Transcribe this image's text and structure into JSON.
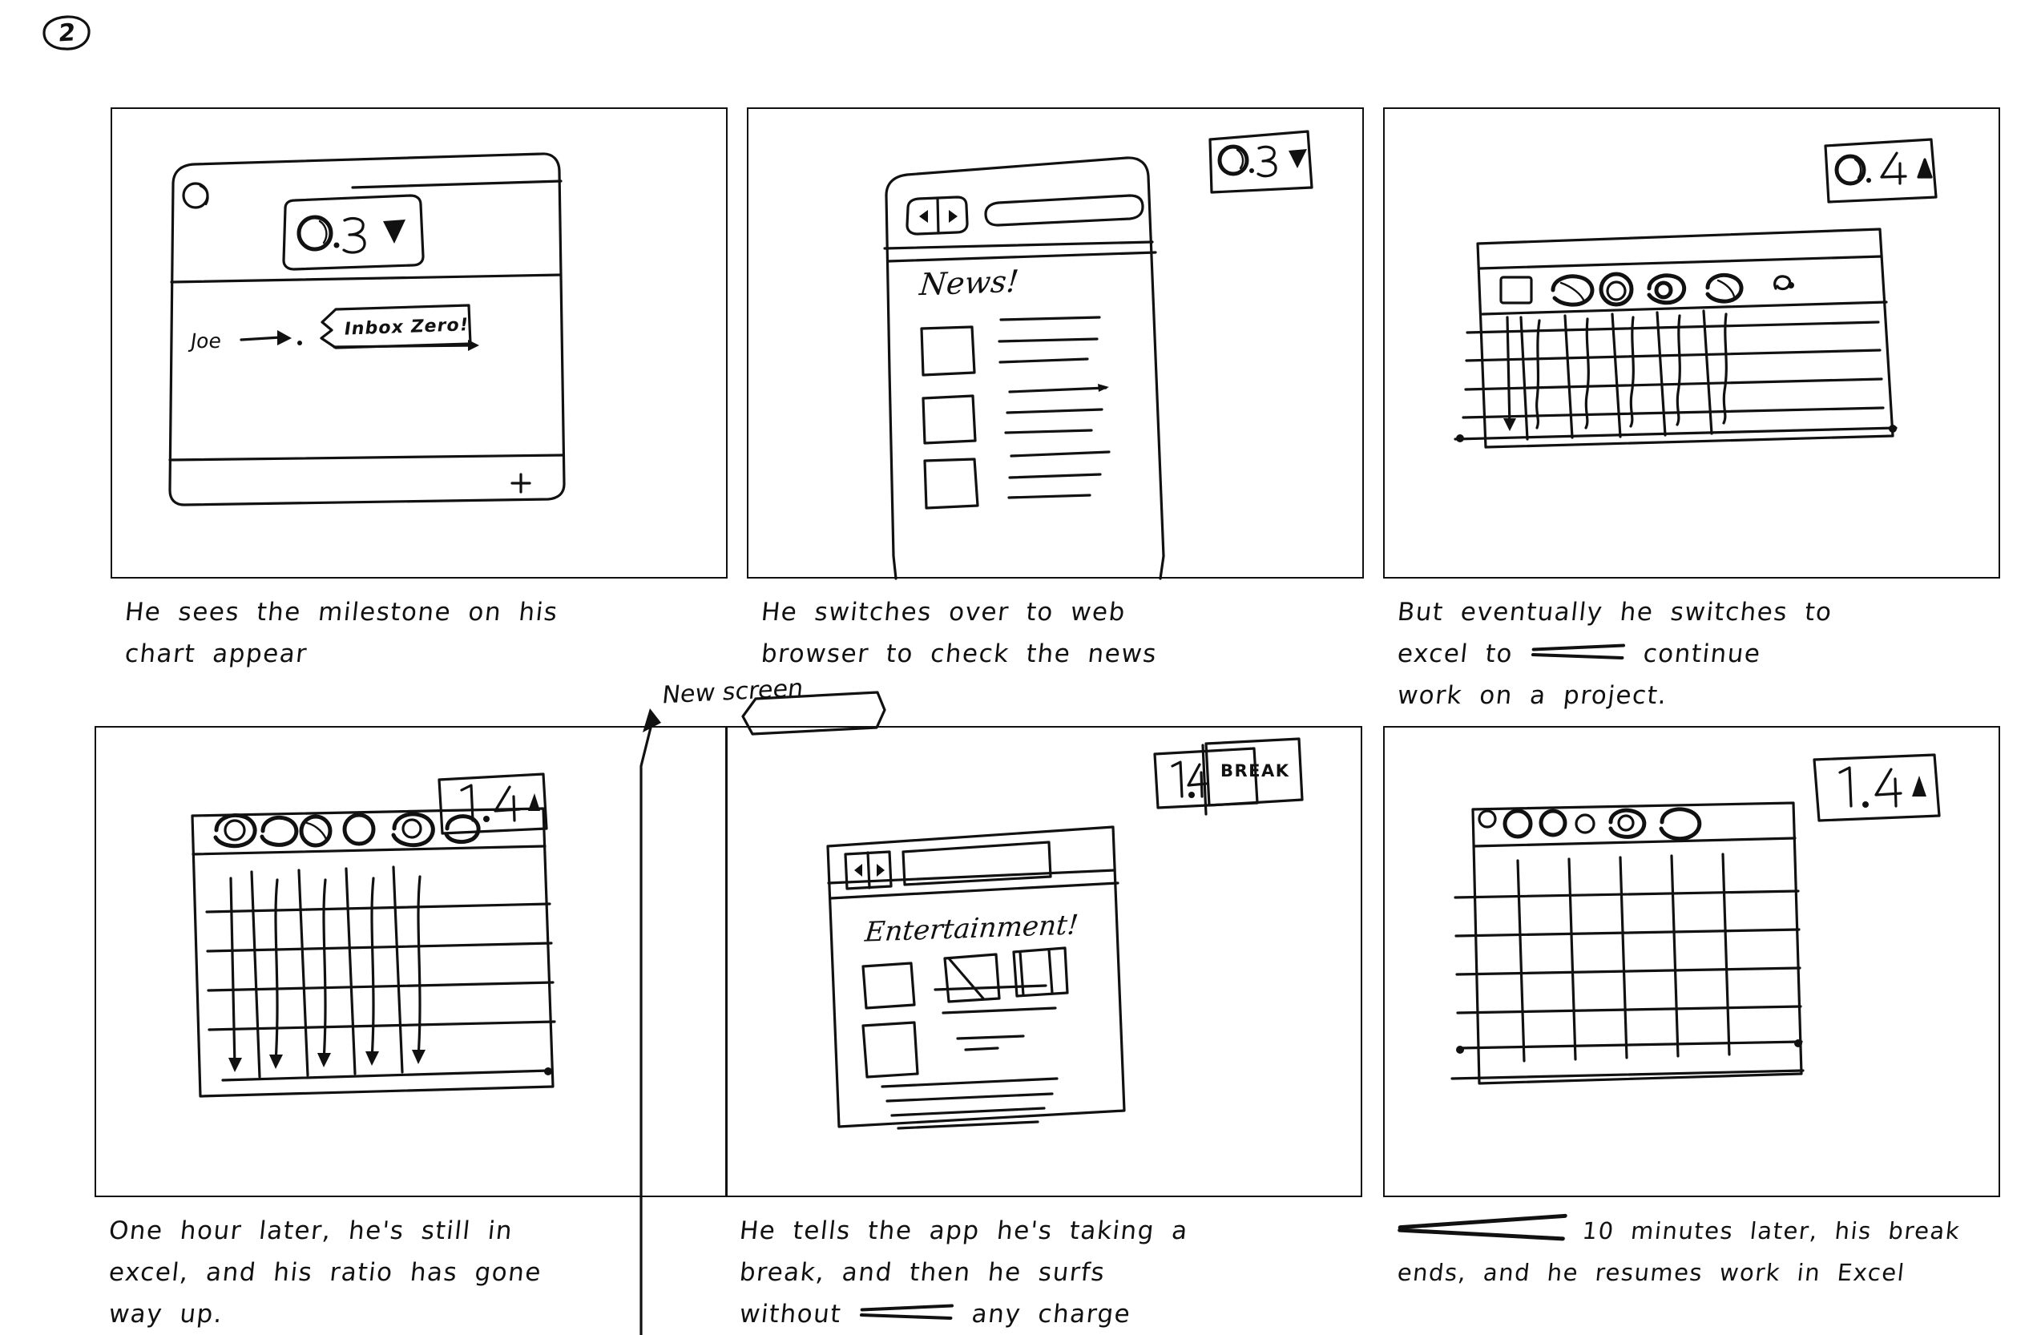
{
  "page": {
    "number": "2"
  },
  "panels": [
    {
      "id": "panel-1",
      "mockup": "email-client-window",
      "badge": {
        "value": "0.3",
        "arrow": "▼",
        "arrow_name": "down-triangle-icon"
      },
      "tooltip": "Inbox Zero!",
      "pointer_label": "Joe",
      "plus_label": "+",
      "caption_lines": [
        "He sees the milestone on his",
        "chart appear"
      ]
    },
    {
      "id": "panel-2",
      "mockup": "mobile-browser-news",
      "badge": {
        "value": "0.3",
        "arrow": "▼",
        "arrow_name": "down-triangle-icon"
      },
      "screen_title": "News!",
      "caption_lines": [
        "He switches over to web",
        "browser to check the news"
      ]
    },
    {
      "id": "panel-3",
      "mockup": "excel-spreadsheet",
      "badge": {
        "value": "0.4",
        "arrow": "▲",
        "arrow_name": "up-triangle-icon"
      },
      "caption_lines": [
        "But eventually he switches to",
        "excel to ~~~~ continue",
        "work on a project."
      ],
      "caption_strikeout": "struck-out-word"
    },
    {
      "id": "panel-4",
      "mockup": "excel-spreadsheet",
      "badge": {
        "value": "1.4",
        "arrow": "▲",
        "arrow_name": "up-triangle-icon"
      },
      "caption_lines": [
        "One hour later, he's still in",
        "excel, and his ratio has gone",
        "way up."
      ]
    },
    {
      "id": "panel-5",
      "mockup": "mobile-browser-entertainment",
      "badge": {
        "value": "1.4",
        "break_label": "BREAK"
      },
      "screen_title": "Entertainment!",
      "annotation": "New screen",
      "caption_lines": [
        "He tells the app he's taking a",
        "break, and then he surfs",
        "without ~~~~ any charge"
      ],
      "caption_strikeout": "struck-out-word"
    },
    {
      "id": "panel-6",
      "mockup": "excel-spreadsheet",
      "badge": {
        "value": "1.4",
        "arrow": "▲",
        "arrow_name": "up-triangle-icon"
      },
      "caption_lines": [
        "~~~~ 10 minutes later, his break",
        "ends, and he resumes work in Excel"
      ],
      "caption_strikeout": "struck-out-phrase"
    }
  ],
  "colors": {
    "ink": "#111111",
    "paper": "#ffffff"
  }
}
